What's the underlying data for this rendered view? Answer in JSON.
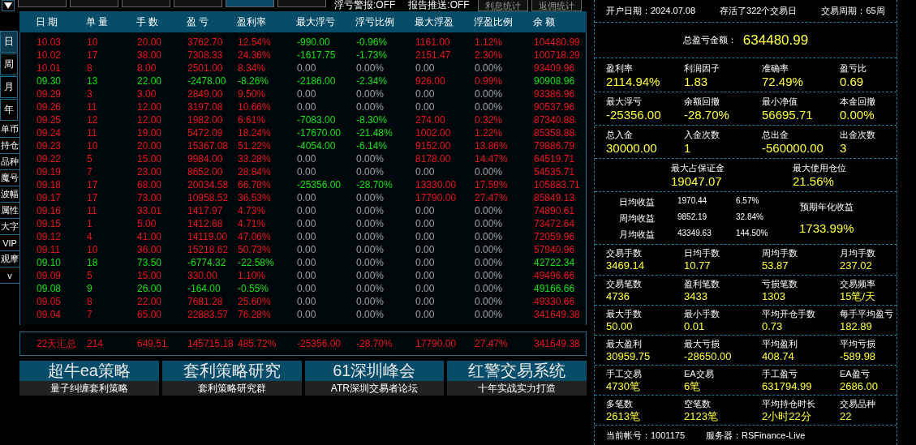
{
  "toolbar": {
    "buttons": [
      {
        "selected": false
      },
      {
        "selected": false
      },
      {
        "selected": false
      },
      {
        "selected": false
      },
      {
        "selected": true
      },
      {
        "selected": false
      }
    ],
    "alerts": [
      "浮亏警报:OFF",
      "报告推送:OFF"
    ],
    "extra_buttons": [
      "利息统计",
      "返佣统计"
    ]
  },
  "sidebar": {
    "periods": [
      {
        "label": "日",
        "selected": true
      },
      {
        "label": "周",
        "selected": false
      },
      {
        "label": "月",
        "selected": false
      },
      {
        "label": "年",
        "selected": false
      }
    ],
    "items": [
      "单币",
      "持仓",
      "品种",
      "魔号",
      "波幅",
      "属性",
      "大字",
      "VIP",
      "观摩",
      "v"
    ]
  },
  "table": {
    "columns": [
      "日 期",
      "单 量",
      "手 数",
      "盈 亏",
      "盈利率",
      "最大浮亏",
      "浮亏比例",
      "最大浮盈",
      "浮盈比例",
      "余 额"
    ],
    "rows": [
      {
        "cells": [
          "10.03",
          "10",
          "20.00",
          "3762.70",
          "12.54%",
          "-990.00",
          "-0.96%",
          "1161.00",
          "1.12%",
          "104480.99"
        ],
        "loss": false,
        "float_loss": true,
        "float_gain": true
      },
      {
        "cells": [
          "10.02",
          "17",
          "38.00",
          "7308.33",
          "24.36%",
          "-1617.75",
          "-1.73%",
          "2151.47",
          "2.30%",
          "100718.29"
        ],
        "loss": false,
        "float_loss": true,
        "float_gain": true
      },
      {
        "cells": [
          "10.01",
          "8",
          "8.00",
          "2501.00",
          "8.34%",
          "0.00",
          "0.00%",
          "0.00",
          "0.00%",
          "93409.96"
        ],
        "loss": false,
        "float_loss": false,
        "float_gain": false
      },
      {
        "cells": [
          "09.30",
          "13",
          "22.00",
          "-2478.00",
          "-8.26%",
          "-2186.00",
          "-2.34%",
          "926.00",
          "0.99%",
          "90908.96"
        ],
        "loss": true,
        "float_loss": true,
        "float_gain": true
      },
      {
        "cells": [
          "09.29",
          "3",
          "3.00",
          "2849.00",
          "9.50%",
          "0.00",
          "0.00%",
          "0.00",
          "0.00%",
          "93386.96"
        ],
        "loss": false,
        "float_loss": false,
        "float_gain": false
      },
      {
        "cells": [
          "09.26",
          "11",
          "12.00",
          "3197.08",
          "10.66%",
          "0.00",
          "0.00%",
          "0.00",
          "0.00%",
          "90537.96"
        ],
        "loss": false,
        "float_loss": false,
        "float_gain": false
      },
      {
        "cells": [
          "09.25",
          "12",
          "12.00",
          "1982.00",
          "6.61%",
          "-7083.00",
          "-8.30%",
          "274.00",
          "0.32%",
          "87340.88"
        ],
        "loss": false,
        "float_loss": true,
        "float_gain": true
      },
      {
        "cells": [
          "09.24",
          "11",
          "19.00",
          "5472.09",
          "18.24%",
          "-17670.00",
          "-21.48%",
          "1002.00",
          "1.22%",
          "85358.88"
        ],
        "loss": false,
        "float_loss": true,
        "float_gain": true
      },
      {
        "cells": [
          "09.23",
          "10",
          "20.00",
          "15367.08",
          "51.22%",
          "-4054.00",
          "-6.14%",
          "9152.00",
          "13.86%",
          "79886.79"
        ],
        "loss": false,
        "float_loss": true,
        "float_gain": true
      },
      {
        "cells": [
          "09.22",
          "5",
          "15.00",
          "9984.00",
          "33.28%",
          "0.00",
          "0.00%",
          "8178.00",
          "14.47%",
          "64519.71"
        ],
        "loss": false,
        "float_loss": false,
        "float_gain": true
      },
      {
        "cells": [
          "09.19",
          "7",
          "23.00",
          "8652.00",
          "28.84%",
          "0.00",
          "0.00%",
          "0.00",
          "0.00%",
          "54535.71"
        ],
        "loss": false,
        "float_loss": false,
        "float_gain": false
      },
      {
        "cells": [
          "09.18",
          "17",
          "68.00",
          "20034.58",
          "66.78%",
          "-25356.00",
          "-28.70%",
          "13330.00",
          "17.59%",
          "105883.71"
        ],
        "loss": false,
        "float_loss": true,
        "float_gain": true
      },
      {
        "cells": [
          "09.17",
          "17",
          "73.00",
          "10958.52",
          "36.53%",
          "0.00",
          "0.00%",
          "17790.00",
          "27.47%",
          "85849.13"
        ],
        "loss": false,
        "float_loss": false,
        "float_gain": true
      },
      {
        "cells": [
          "09.16",
          "11",
          "33.01",
          "1417.97",
          "4.73%",
          "0.00",
          "0.00%",
          "0.00",
          "0.00%",
          "74890.61"
        ],
        "loss": false,
        "float_loss": false,
        "float_gain": false
      },
      {
        "cells": [
          "09.15",
          "1",
          "5.00",
          "1412.68",
          "4.71%",
          "0.00",
          "0.00%",
          "0.00",
          "0.00%",
          "73472.64"
        ],
        "loss": false,
        "float_loss": false,
        "float_gain": false
      },
      {
        "cells": [
          "09.12",
          "4",
          "41.00",
          "14119.00",
          "47.06%",
          "0.00",
          "0.00%",
          "0.00",
          "0.00%",
          "72059.96"
        ],
        "loss": false,
        "float_loss": false,
        "float_gain": false
      },
      {
        "cells": [
          "09.11",
          "10",
          "36.00",
          "15218.62",
          "50.73%",
          "0.00",
          "0.00%",
          "0.00",
          "0.00%",
          "57940.96"
        ],
        "loss": false,
        "float_loss": false,
        "float_gain": false
      },
      {
        "cells": [
          "09.10",
          "18",
          "73.50",
          "-6774.32",
          "-22.58%",
          "0.00",
          "0.00%",
          "0.00",
          "0.00%",
          "42722.34"
        ],
        "loss": true,
        "float_loss": false,
        "float_gain": false
      },
      {
        "cells": [
          "09.09",
          "5",
          "15.00",
          "330.00",
          "1.10%",
          "0.00",
          "0.00%",
          "0.00",
          "0.00%",
          "49496.66"
        ],
        "loss": false,
        "float_loss": false,
        "float_gain": false
      },
      {
        "cells": [
          "09.08",
          "9",
          "26.00",
          "-164.00",
          "-0.55%",
          "0.00",
          "0.00%",
          "0.00",
          "0.00%",
          "49166.66"
        ],
        "loss": true,
        "float_loss": false,
        "float_gain": false
      },
      {
        "cells": [
          "09.05",
          "8",
          "22.00",
          "7681.28",
          "25.60%",
          "0.00",
          "0.00%",
          "0.00",
          "0.00%",
          "49330.66"
        ],
        "loss": false,
        "float_loss": false,
        "float_gain": false
      },
      {
        "cells": [
          "09.04",
          "7",
          "65.00",
          "22883.57",
          "76.28%",
          "0.00",
          "0.00%",
          "0.00",
          "0.00%",
          "341649.38"
        ],
        "loss": false,
        "float_loss": false,
        "float_gain": false
      }
    ],
    "summary": [
      "22天汇总",
      "214",
      "649.51",
      "145715.18",
      "485.72%",
      "-25356.00",
      "-28.70%",
      "17790.00",
      "27.47%",
      "341649.38"
    ]
  },
  "banners": [
    {
      "title": "超牛ea策略",
      "subtitle": "量子纠缠套利策略"
    },
    {
      "title": "套利策略研究",
      "subtitle": "套利策略研究群"
    },
    {
      "title": "61深圳峰会",
      "subtitle": "ATR深圳交易者论坛"
    },
    {
      "title": "红警交易系统",
      "subtitle": "十年实战实力打造"
    }
  ],
  "stats": {
    "header": [
      "开户日期：2024.07.08",
      "存活了322个交易日",
      "交易周期：65周"
    ],
    "total": {
      "label": "总盈亏金额：",
      "value": "634480.99"
    },
    "groups": [
      [
        {
          "label": "盈利率",
          "value": "2114.94%"
        },
        {
          "label": "利润因子",
          "value": "1.83"
        },
        {
          "label": "准确率",
          "value": "72.49%"
        },
        {
          "label": "盈亏比",
          "value": "0.69"
        }
      ],
      [
        {
          "label": "最大浮亏",
          "value": "-25356.00"
        },
        {
          "label": "余额回撤",
          "value": "-28.70%"
        },
        {
          "label": "最小净值",
          "value": "56695.71"
        },
        {
          "label": "本金回撤",
          "value": "0.00%"
        }
      ],
      [
        {
          "label": "总入金",
          "value": "30000.00"
        },
        {
          "label": "入金次数",
          "value": "1"
        },
        {
          "label": "总出金",
          "value": "-560000.00"
        },
        {
          "label": "出金次数",
          "value": "3"
        }
      ]
    ],
    "margin": [
      {
        "label": "最大占保证金",
        "value": "19047.07"
      },
      {
        "label": "最大使用仓位",
        "value": "21.56%"
      }
    ],
    "returns": [
      {
        "label": "日均收益",
        "amount": "1970.44",
        "percent": "6.57%"
      },
      {
        "label": "周均收益",
        "amount": "9852.19",
        "percent": "32.84%"
      },
      {
        "label": "月均收益",
        "amount": "43349.63",
        "percent": "144.50%"
      }
    ],
    "annual": {
      "label": "预期年化收益",
      "value": "1733.99%"
    },
    "small_groups": [
      [
        {
          "label": "交易手数",
          "value": "3469.14"
        },
        {
          "label": "日均手数",
          "value": "10.77"
        },
        {
          "label": "周均手数",
          "value": "53.87"
        },
        {
          "label": "月均手数",
          "value": "237.02"
        }
      ],
      [
        {
          "label": "交易笔数",
          "value": "4736"
        },
        {
          "label": "盈利笔数",
          "value": "3433"
        },
        {
          "label": "亏损笔数",
          "value": "1303"
        },
        {
          "label": "交易频率",
          "value": "15笔/天"
        }
      ],
      [
        {
          "label": "最大手数",
          "value": "50.00"
        },
        {
          "label": "最小手数",
          "value": "0.01"
        },
        {
          "label": "平均开仓手数",
          "value": "0.73"
        },
        {
          "label": "每手平均盈亏",
          "value": "182.89"
        }
      ],
      [
        {
          "label": "最大盈利",
          "value": "30959.75"
        },
        {
          "label": "最大亏损",
          "value": "-28650.00"
        },
        {
          "label": "平均盈利",
          "value": "408.74"
        },
        {
          "label": "平均亏损",
          "value": "-589.98"
        }
      ],
      [
        {
          "label": "手工交易",
          "value": "4730笔"
        },
        {
          "label": "EA交易",
          "value": "6笔"
        },
        {
          "label": "手工盈亏",
          "value": "631794.99"
        },
        {
          "label": "EA盈亏",
          "value": "2686.00"
        }
      ],
      [
        {
          "label": "多笔数",
          "value": "2613笔"
        },
        {
          "label": "空笔数",
          "value": "2123笔"
        },
        {
          "label": "平均持仓时长",
          "value": "2小时22分"
        },
        {
          "label": "交易品种",
          "value": "22"
        }
      ]
    ],
    "footer": [
      "当前帐号：1001175",
      "服务器：RSFinance-Live"
    ]
  }
}
